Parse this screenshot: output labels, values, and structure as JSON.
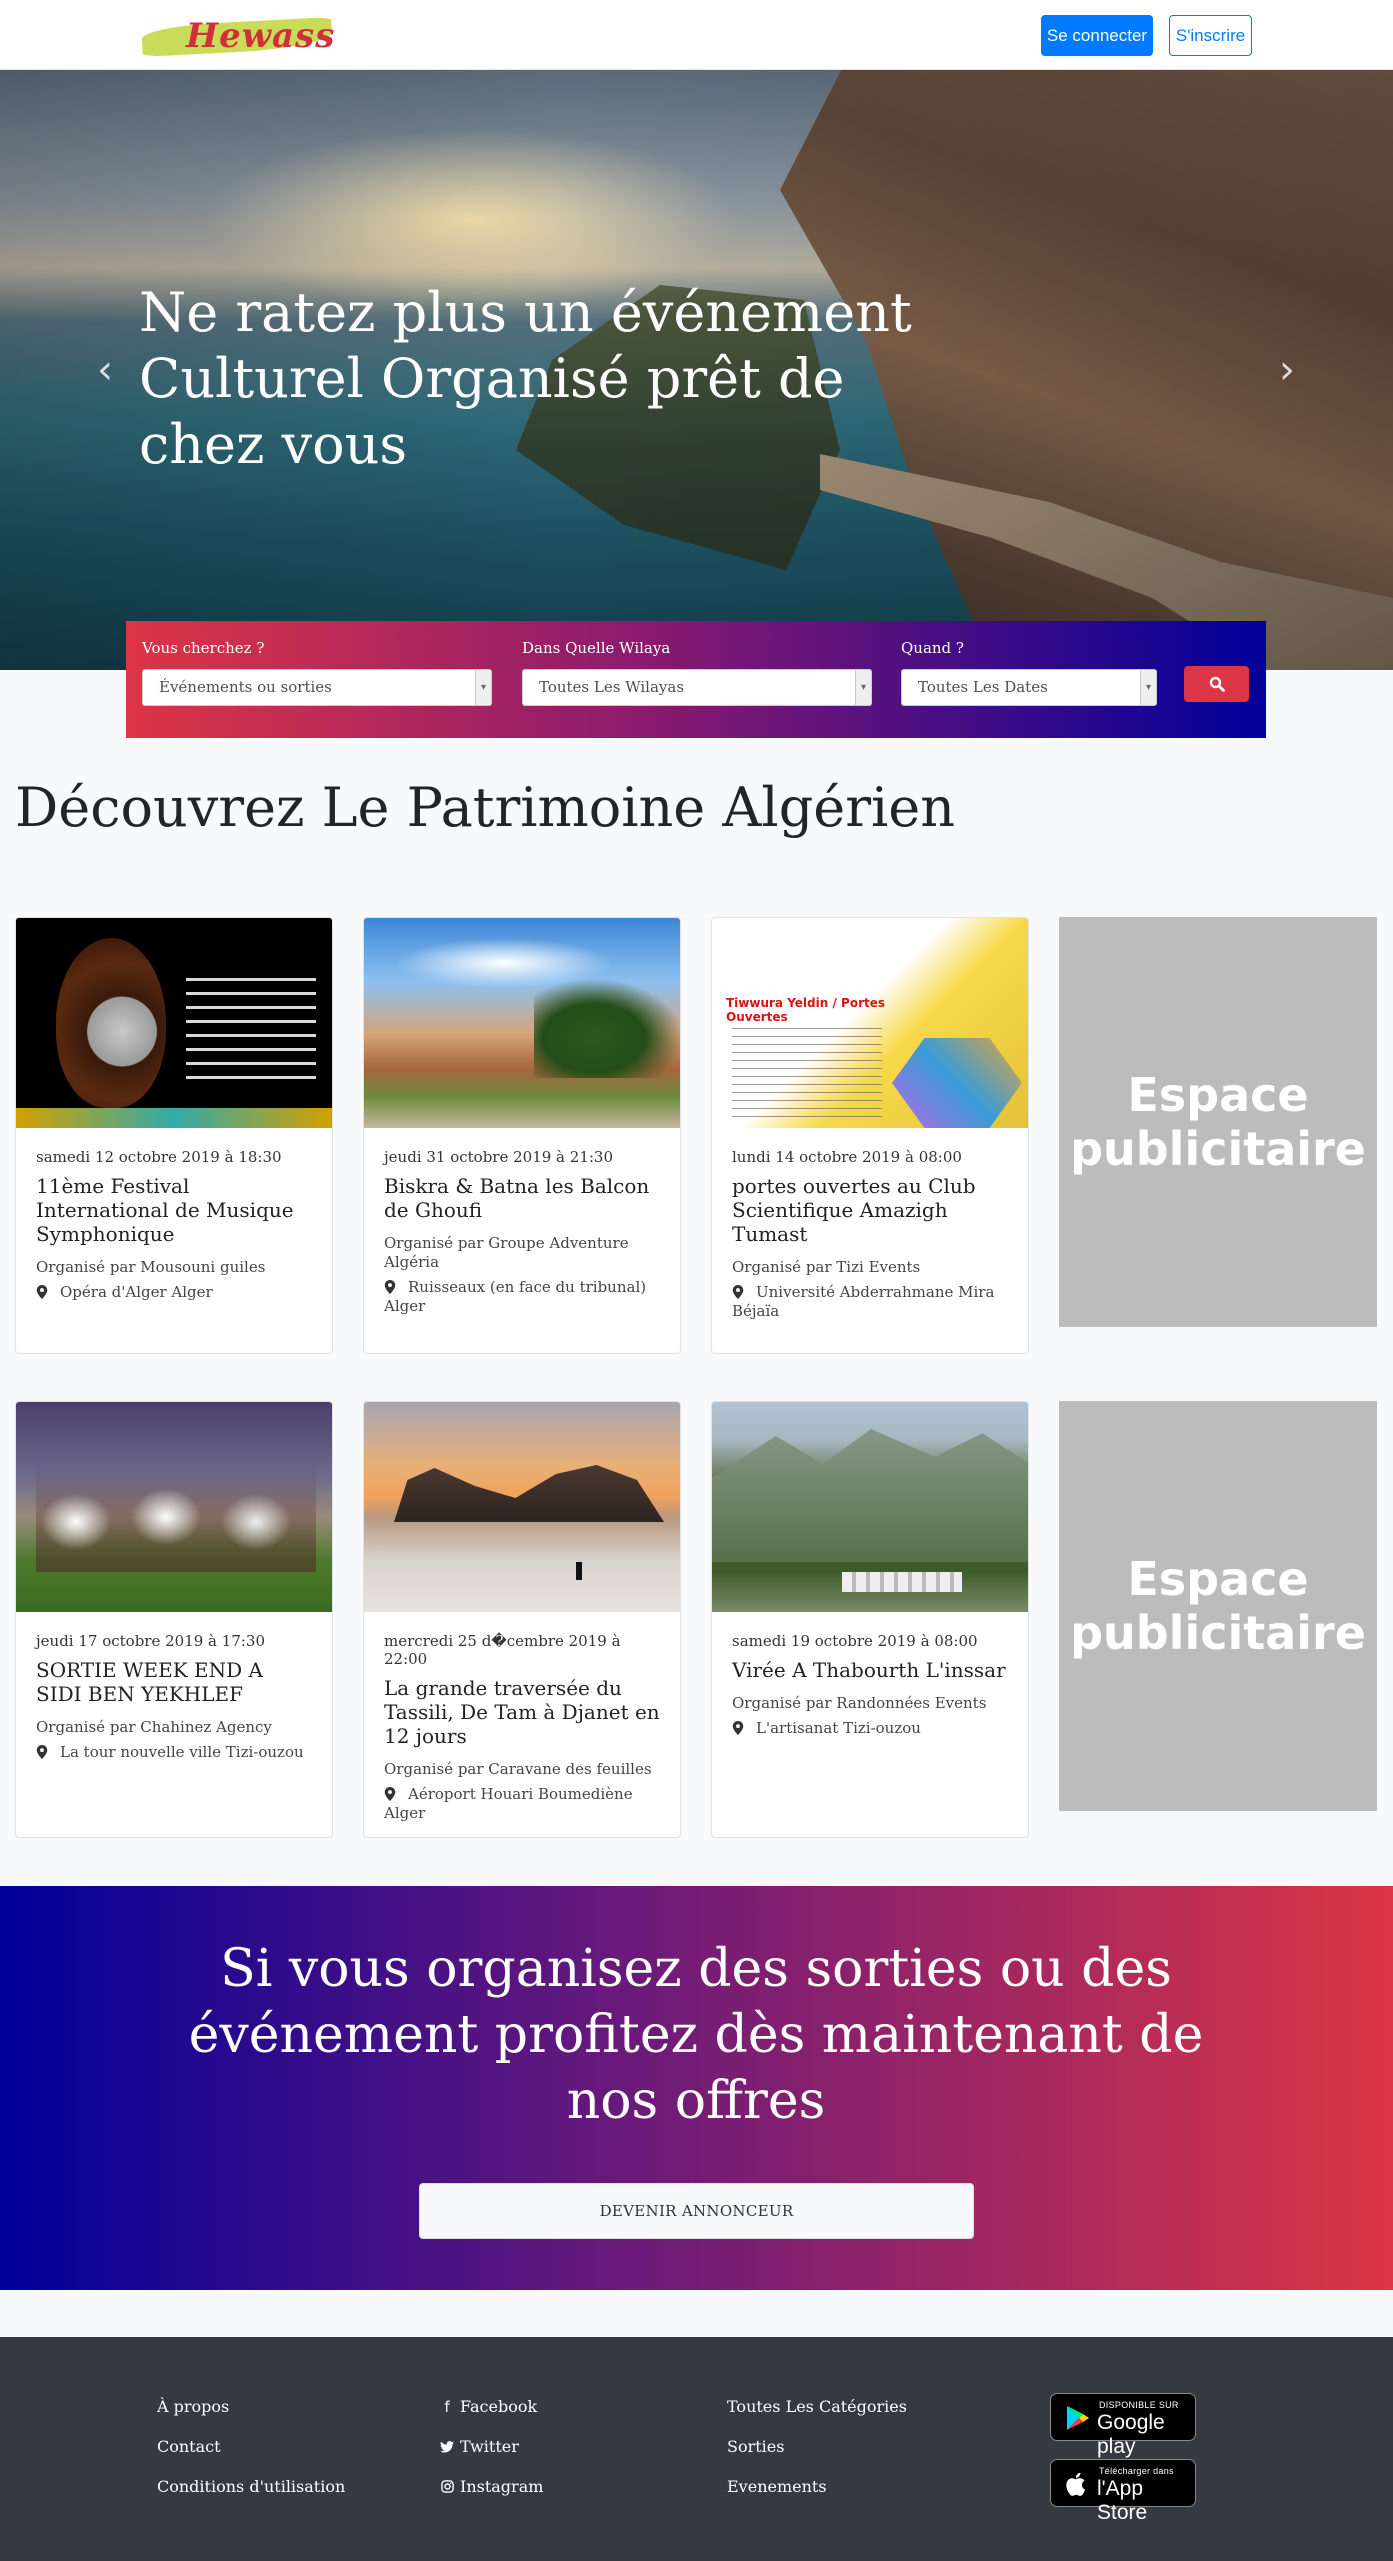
{
  "navbar": {
    "logo_text": "Hewass",
    "login_label": "Se connecter",
    "signup_label": "S'inscrire"
  },
  "hero": {
    "title": "Ne ratez plus un événement Culturel Organisé prêt de chez vous",
    "prev_icon": "‹",
    "next_icon": "›"
  },
  "search": {
    "what_label": "Vous cherchez ?",
    "what_value": "Événements ou sorties",
    "where_label": "Dans Quelle Wilaya",
    "where_value": "Toutes Les Wilayas",
    "when_label": "Quand ?",
    "when_value": "Toutes Les Dates",
    "button_icon": "search-icon"
  },
  "section": {
    "title": "Découvrez Le Patrimoine Algérien"
  },
  "events": [
    {
      "date": "samedi 12 octobre 2019 à 18:30",
      "title": "11ème Festival International de Musique Symphonique",
      "organizer": "Organisé par Mousouni guiles",
      "location": "Opéra d'Alger Alger"
    },
    {
      "date": "jeudi 31 octobre 2019 à 21:30",
      "title": "Biskra & Batna les Balcon de Ghoufi",
      "organizer": "Organisé par Groupe Adventure Algéria",
      "location": "Ruisseaux (en face du tribunal) Alger"
    },
    {
      "date": "lundi 14 octobre 2019 à 08:00",
      "title": "portes ouvertes au Club Scientifique Amazigh Tumast",
      "organizer": "Organisé par Tizi Events",
      "location": "Université Abderrahmane Mira Béjaïa"
    },
    {
      "date": "jeudi 17 octobre 2019 à 17:30",
      "title": "SORTIE WEEK END A SIDI BEN YEKHLEF",
      "organizer": "Organisé par Chahinez Agency",
      "location": "La tour nouvelle ville Tizi-ouzou"
    },
    {
      "date": "mercredi 25 d�cembre 2019 à 22:00",
      "title": "La grande traversée du Tassili, De Tam à Djanet en 12 jours",
      "organizer": "Organisé par Caravane des feuilles",
      "location": "Aéroport Houari Boumediène Alger"
    },
    {
      "date": "samedi 19 octobre 2019 à 08:00",
      "title": "Virée A Thabourth L'inssar",
      "organizer": "Organisé par Randonnées Events",
      "location": "L'artisanat Tizi-ouzou"
    }
  ],
  "poster_text": "Tiwwura Yeldin / Portes Ouvertes",
  "ads": [
    {
      "text": "Espace publicitaire"
    },
    {
      "text": "Espace publicitaire"
    }
  ],
  "cta": {
    "text": "Si vous organisez des sorties ou des événement profitez dès maintenant de nos offres",
    "button_label": "DEVENIR ANNONCEUR"
  },
  "footer": {
    "col1": [
      "À propos",
      "Contact",
      "Conditions d'utilisation"
    ],
    "col2": [
      "Facebook",
      "Twitter",
      "Instagram"
    ],
    "col3": [
      "Toutes Les Catégories",
      "Sorties",
      "Evenements"
    ],
    "google_small": "DISPONIBLE SUR",
    "google_big": "Google play",
    "apple_small": "Télécharger dans",
    "apple_big": "l'App Store"
  },
  "colors": {
    "primary": "#007bff",
    "danger": "#dc3545",
    "deep_blue": "#000099",
    "footer_bg": "#343a40",
    "ad_gray": "#bcbcbc"
  }
}
